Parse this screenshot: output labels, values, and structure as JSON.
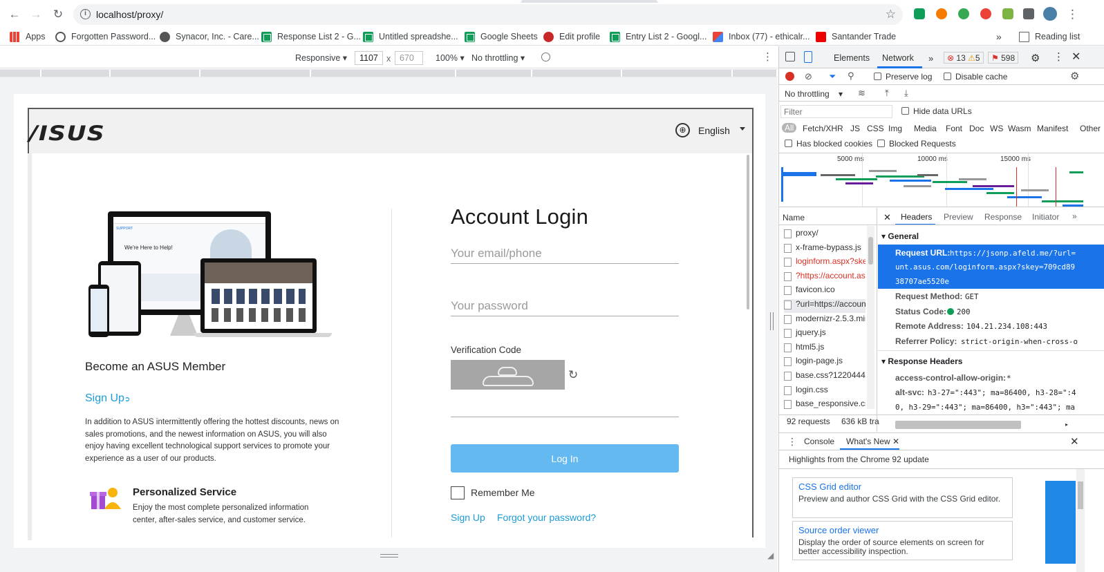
{
  "browser": {
    "url": "localhost/proxy/",
    "back_icon": "←",
    "forward_icon": "→",
    "reload_icon": "↻",
    "menu_icon": "⋮"
  },
  "bookmarks": [
    {
      "label": "Apps",
      "icon": "apps-grid-icon"
    },
    {
      "label": "Forgotten Password...",
      "icon": "synacor-icon"
    },
    {
      "label": "Synacor, Inc. - Care...",
      "icon": "globe-icon"
    },
    {
      "label": "Response List 2 - G...",
      "icon": "google-sheets-icon"
    },
    {
      "label": "Untitled spreadshe...",
      "icon": "google-sheets-icon"
    },
    {
      "label": "Google Sheets",
      "icon": "google-sheets-icon"
    },
    {
      "label": "Edit profile",
      "icon": "profile-icon"
    },
    {
      "label": "Entry List 2 - Googl...",
      "icon": "google-sheets-icon"
    },
    {
      "label": "Inbox (77) - ethicalr...",
      "icon": "gmail-icon"
    },
    {
      "label": "Santander Trade",
      "icon": "santander-icon"
    }
  ],
  "more_bookmarks": "»",
  "reading_list": "Reading list",
  "device_toolbar": {
    "mode": "Responsive",
    "width": "1107",
    "height": "670",
    "times": "x",
    "zoom": "100%",
    "throttle": "No throttling"
  },
  "page": {
    "logo": "/ISUS",
    "language": "English",
    "member_title": "Become an ASUS Member",
    "signup_big": "Sign Up",
    "member_text": "In addition to ASUS intermittently offering the hottest discounts, news on sales promotions, and the newest information on ASUS, you will also enjoy having excellent technological support services to promote your experience as a user of our products.",
    "ps_title": "Personalized Service",
    "ps_text": "Enjoy the most complete personalized information center, after-sales service, and customer service.",
    "illustration_heading": "We're Here to Help!",
    "illustration_support": "SUPPORT"
  },
  "login": {
    "title": "Account Login",
    "email_placeholder": "Your email/phone",
    "password_placeholder": "Your password",
    "verification_label": "Verification Code",
    "button": "Log In",
    "remember": "Remember Me",
    "signup": "Sign Up",
    "forgot": "Forgot your password?"
  },
  "devtools": {
    "tabs": [
      "Elements",
      "Network"
    ],
    "more_tabs": "»",
    "errors": "13",
    "warnings": "5",
    "issues": "598",
    "preserve_log": "Preserve log",
    "disable_cache": "Disable cache",
    "throttling": "No throttling",
    "filter_placeholder": "Filter",
    "hide_data_urls": "Hide data URLs",
    "types": [
      "All",
      "Fetch/XHR",
      "JS",
      "CSS",
      "Img",
      "Media",
      "Font",
      "Doc",
      "WS",
      "Wasm",
      "Manifest",
      "Other"
    ],
    "has_blocked_cookies": "Has blocked cookies",
    "blocked_requests": "Blocked Requests",
    "timeline_ticks": [
      "5000 ms",
      "10000 ms",
      "15000 ms"
    ],
    "name_header": "Name",
    "requests": [
      {
        "name": "proxy/",
        "status": "normal"
      },
      {
        "name": "x-frame-bypass.js",
        "status": "normal"
      },
      {
        "name": "loginform.aspx?skey",
        "status": "error"
      },
      {
        "name": "?https://account.asu",
        "status": "error"
      },
      {
        "name": "favicon.ico",
        "status": "normal"
      },
      {
        "name": "?url=https://accoun",
        "status": "selected"
      },
      {
        "name": "modernizr-2.5.3.min",
        "status": "normal"
      },
      {
        "name": "jquery.js",
        "status": "normal"
      },
      {
        "name": "html5.js",
        "status": "normal"
      },
      {
        "name": "login-page.js",
        "status": "normal"
      },
      {
        "name": "base.css?1220444",
        "status": "normal"
      },
      {
        "name": "login.css",
        "status": "normal"
      },
      {
        "name": "base_responsive.css",
        "status": "normal"
      }
    ],
    "summary_requests": "92 requests",
    "summary_size": "636 kB tra",
    "detail_tabs": [
      "Headers",
      "Preview",
      "Response",
      "Initiator"
    ],
    "general_title": "General",
    "request_url_label": "Request URL:",
    "request_url_lines": [
      "https://jsonp.afeld.me/?url=",
      "unt.asus.com/loginform.aspx?skey=709cd89",
      "38707ae5520e"
    ],
    "request_method_label": "Request Method:",
    "request_method": "GET",
    "status_code_label": "Status Code:",
    "status_code": "200",
    "remote_address_label": "Remote Address:",
    "remote_address": "104.21.234.108:443",
    "referrer_policy_label": "Referrer Policy:",
    "referrer_policy": "strict-origin-when-cross-o",
    "response_headers_title": "Response Headers",
    "acao_label": "access-control-allow-origin:",
    "acao_value": "*",
    "alt_svc_label": "alt-svc:",
    "alt_svc_line1": "h3-27=\":443\"; ma=86400, h3-28=\":4",
    "alt_svc_line2": "0, h3-29=\":443\"; ma=86400, h3=\":443\"; ma",
    "drawer_tabs": [
      "Console",
      "What's New"
    ],
    "drawer_heading": "Highlights from the Chrome 92 update",
    "cards": [
      {
        "title": "CSS Grid editor",
        "desc": "Preview and author CSS Grid with the CSS Grid editor."
      },
      {
        "title": "Source order viewer",
        "desc": "Display the order of source elements on screen for better accessibility inspection."
      }
    ]
  }
}
